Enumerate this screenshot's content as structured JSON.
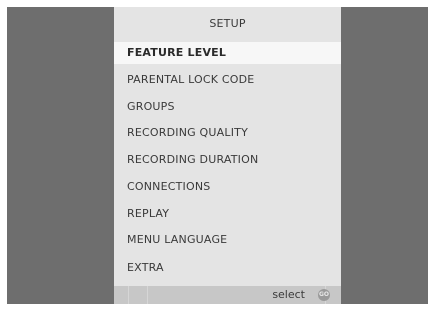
{
  "menu": {
    "title": "SETUP",
    "items": [
      {
        "label": "FEATURE  LEVEL",
        "selected": true
      },
      {
        "label": "PARENTAL  LOCK  CODE",
        "selected": false
      },
      {
        "label": "GROUPS",
        "selected": false
      },
      {
        "label": "RECORDING  QUALITY",
        "selected": false
      },
      {
        "label": "RECORDING  DURATION",
        "selected": false
      },
      {
        "label": "CONNECTIONS",
        "selected": false
      },
      {
        "label": "REPLAY",
        "selected": false
      },
      {
        "label": "MENU  LANGUAGE",
        "selected": false
      },
      {
        "label": "EXTRA",
        "selected": false
      }
    ]
  },
  "footer": {
    "hint_label": "select",
    "go_icon_label": "GO",
    "go_icon": "go-button-icon"
  },
  "colors": {
    "frame": "#6e6e6e",
    "panel": "#e4e4e4",
    "selected_row": "#f7f7f7",
    "footer_bar": "#c7c7c7",
    "text": "#3a3a3a"
  }
}
